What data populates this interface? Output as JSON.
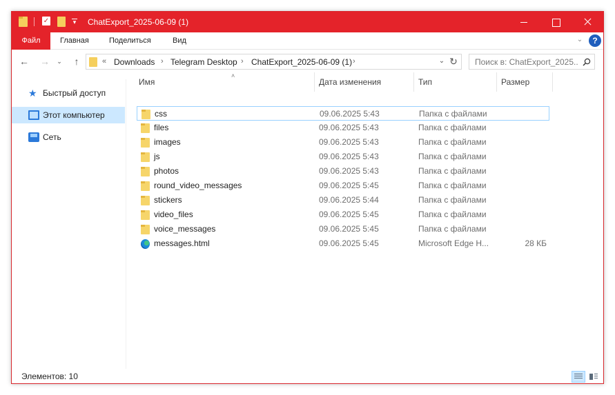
{
  "window": {
    "title": "ChatExport_2025-06-09 (1)",
    "accent": "#e4232a"
  },
  "ribbon": {
    "tabs": [
      "Файл",
      "Главная",
      "Поделиться",
      "Вид"
    ]
  },
  "address": {
    "prefix": "«",
    "crumbs": [
      "Downloads",
      "Telegram Desktop",
      "ChatExport_2025-06-09 (1)"
    ],
    "search_placeholder": "Поиск в: ChatExport_2025..."
  },
  "navpane": {
    "items": [
      {
        "label": "Быстрый доступ",
        "icon": "star-icon"
      },
      {
        "label": "Этот компьютер",
        "icon": "computer-icon",
        "selected": true
      },
      {
        "label": "Сеть",
        "icon": "network-icon"
      }
    ]
  },
  "columns": {
    "name": "Имя",
    "date": "Дата изменения",
    "type": "Тип",
    "size": "Размер"
  },
  "files": [
    {
      "name": "css",
      "date": "09.06.2025 5:43",
      "type": "Папка с файлами",
      "size": "",
      "icon": "folder-icon"
    },
    {
      "name": "files",
      "date": "09.06.2025 5:43",
      "type": "Папка с файлами",
      "size": "",
      "icon": "folder-icon"
    },
    {
      "name": "images",
      "date": "09.06.2025 5:43",
      "type": "Папка с файлами",
      "size": "",
      "icon": "folder-icon"
    },
    {
      "name": "js",
      "date": "09.06.2025 5:43",
      "type": "Папка с файлами",
      "size": "",
      "icon": "folder-icon"
    },
    {
      "name": "photos",
      "date": "09.06.2025 5:43",
      "type": "Папка с файлами",
      "size": "",
      "icon": "folder-icon"
    },
    {
      "name": "round_video_messages",
      "date": "09.06.2025 5:45",
      "type": "Папка с файлами",
      "size": "",
      "icon": "folder-icon"
    },
    {
      "name": "stickers",
      "date": "09.06.2025 5:44",
      "type": "Папка с файлами",
      "size": "",
      "icon": "folder-icon"
    },
    {
      "name": "video_files",
      "date": "09.06.2025 5:45",
      "type": "Папка с файлами",
      "size": "",
      "icon": "folder-icon"
    },
    {
      "name": "voice_messages",
      "date": "09.06.2025 5:45",
      "type": "Папка с файлами",
      "size": "",
      "icon": "folder-icon"
    },
    {
      "name": "messages.html",
      "date": "09.06.2025 5:45",
      "type": "Microsoft Edge H...",
      "size": "28 КБ",
      "icon": "edge-icon"
    }
  ],
  "status": {
    "items_text": "Элементов: 10"
  }
}
